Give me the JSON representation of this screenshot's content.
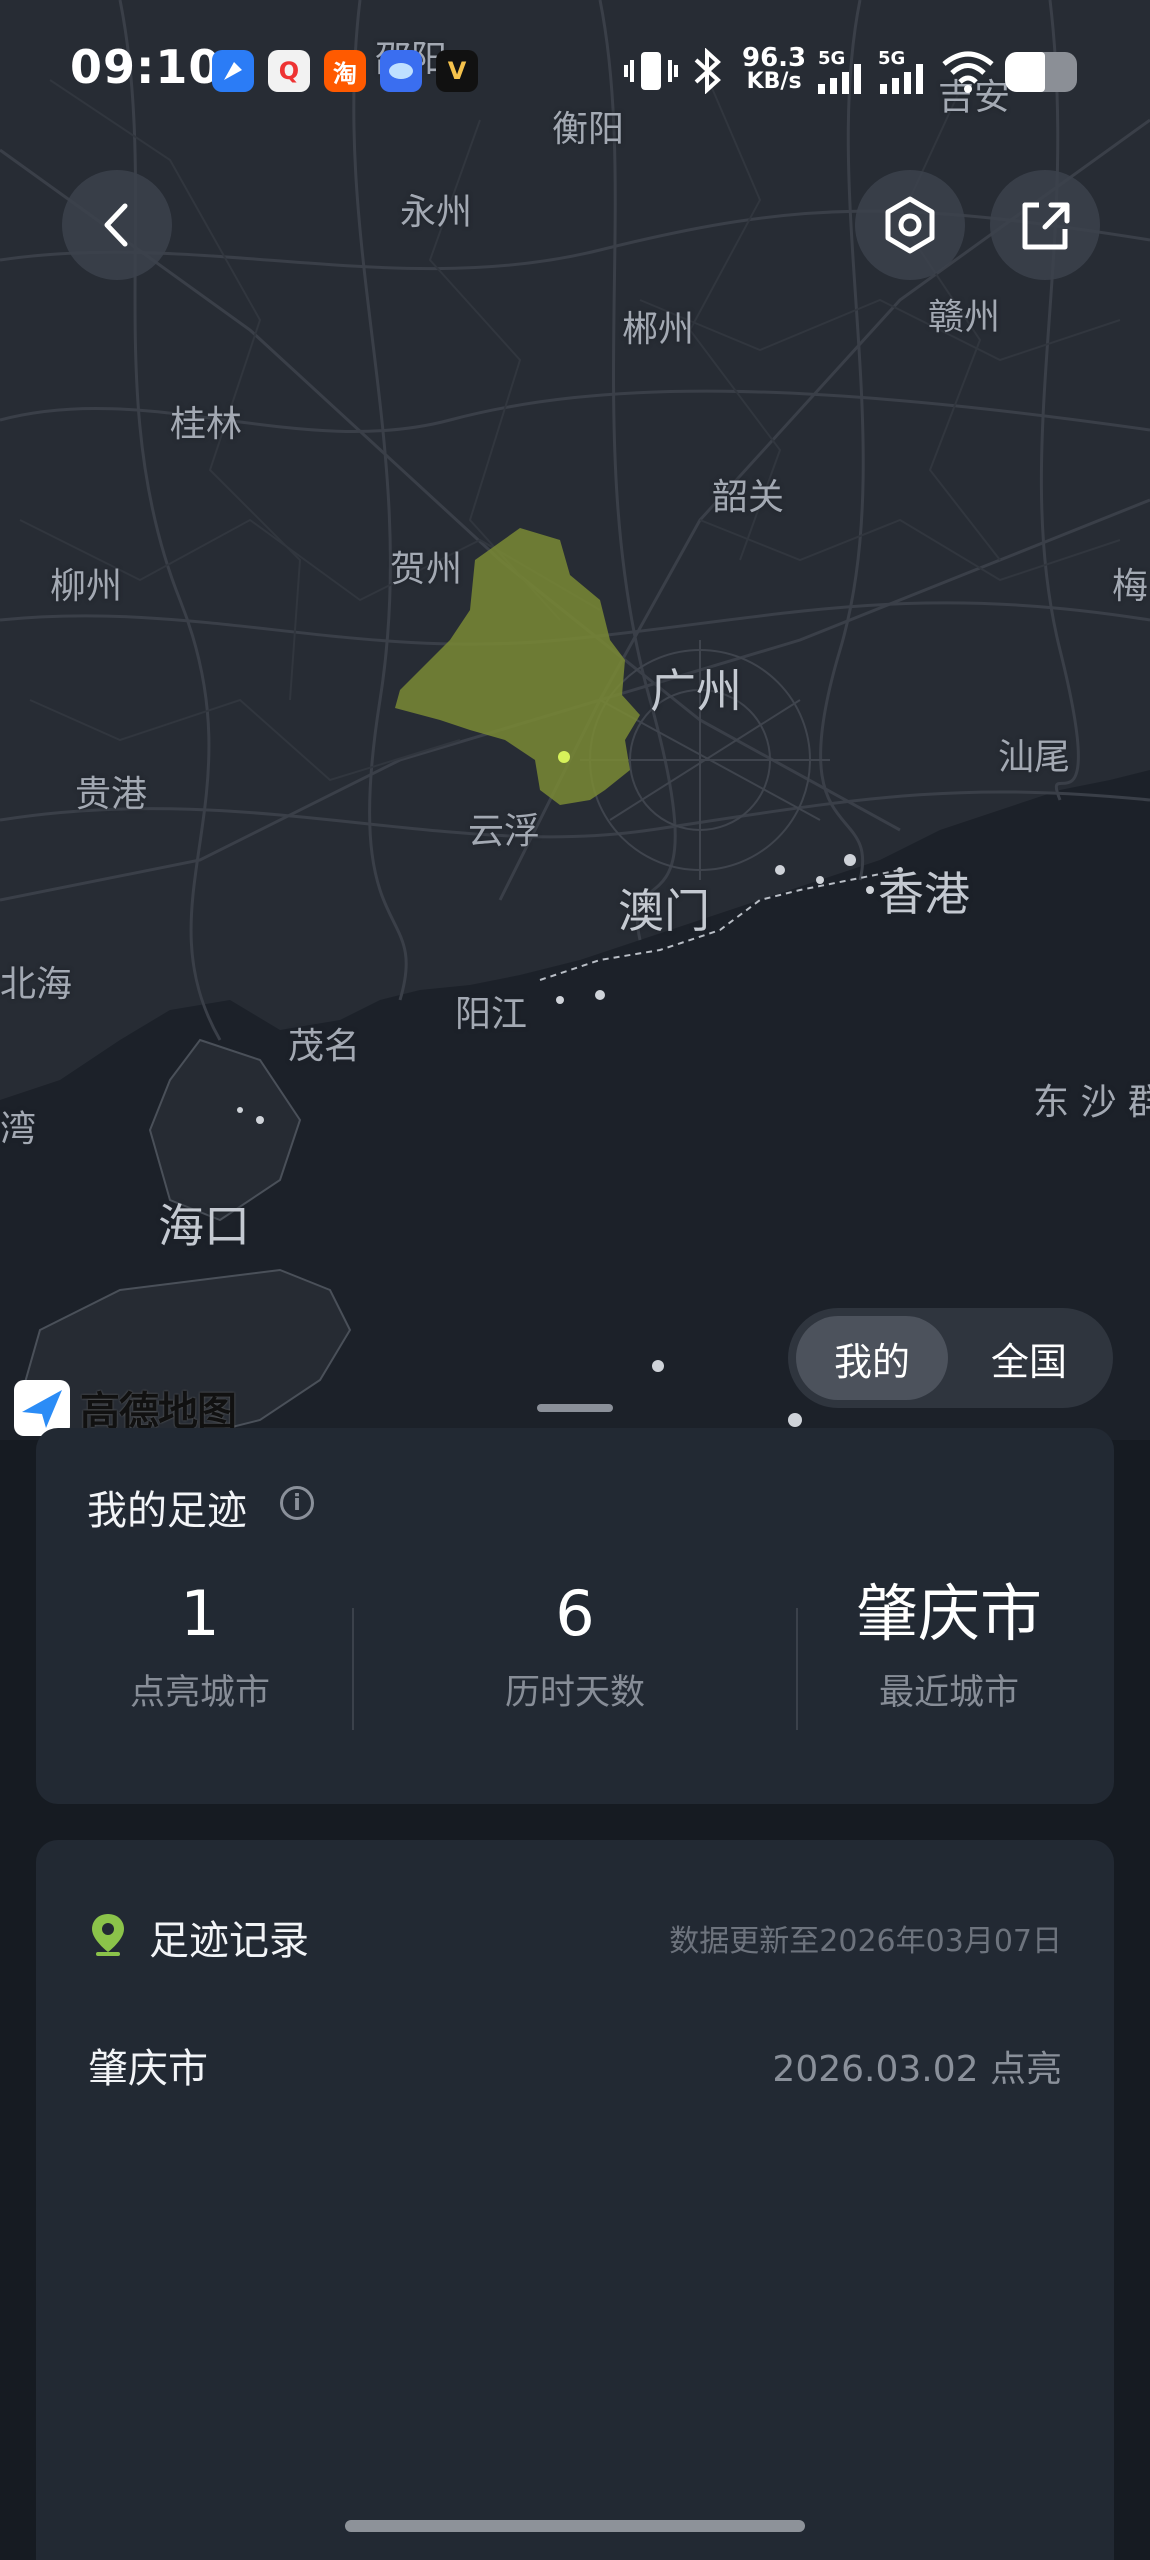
{
  "status_bar": {
    "time": "09:10",
    "apps": [
      {
        "icon": "browser-app-icon",
        "text": "",
        "color": "#2b7cf6"
      },
      {
        "icon": "quark-app-icon",
        "text": "Q",
        "color": "#f2f2f2"
      },
      {
        "icon": "taobao-app-icon",
        "text": "淘",
        "color": "#ff5a00"
      },
      {
        "icon": "xianyu-app-icon",
        "text": "",
        "color": "#3a6ef0"
      },
      {
        "icon": "v-app-icon",
        "text": "V",
        "color": "#111111"
      }
    ],
    "net_speed_value": "96.3",
    "net_speed_unit": "KB/s",
    "signal1": "5G",
    "signal2": "5G"
  },
  "map": {
    "labels": [
      {
        "text": "邵阳"
      },
      {
        "text": "衡阳"
      },
      {
        "text": "吉安"
      },
      {
        "text": "永州"
      },
      {
        "text": "郴州"
      },
      {
        "text": "赣州"
      },
      {
        "text": "桂林"
      },
      {
        "text": "韶关"
      },
      {
        "text": "贺州"
      },
      {
        "text": "柳州"
      },
      {
        "text": "梅"
      },
      {
        "text": "广州"
      },
      {
        "text": "汕尾"
      },
      {
        "text": "贵港"
      },
      {
        "text": "云浮"
      },
      {
        "text": "澳门"
      },
      {
        "text": "香港"
      },
      {
        "text": "北海"
      },
      {
        "text": "阳江"
      },
      {
        "text": "茂名"
      },
      {
        "text": "东 沙 群"
      },
      {
        "text": "湾"
      },
      {
        "text": "海口"
      }
    ],
    "highlight_color": "#7a8a35",
    "logo_text": "高德地图"
  },
  "toggle": {
    "mine": "我的",
    "national": "全国",
    "active": "mine"
  },
  "footprint": {
    "title": "我的足迹",
    "stats": [
      {
        "value": "1",
        "label": "点亮城市"
      },
      {
        "value": "6",
        "label": "历时天数"
      },
      {
        "value": "肇庆市",
        "label": "最近城市"
      }
    ]
  },
  "record": {
    "title": "足迹记录",
    "updated": "数据更新至2026年03月07日",
    "items": [
      {
        "city": "肇庆市",
        "date": "2026.03.02 点亮"
      }
    ]
  }
}
